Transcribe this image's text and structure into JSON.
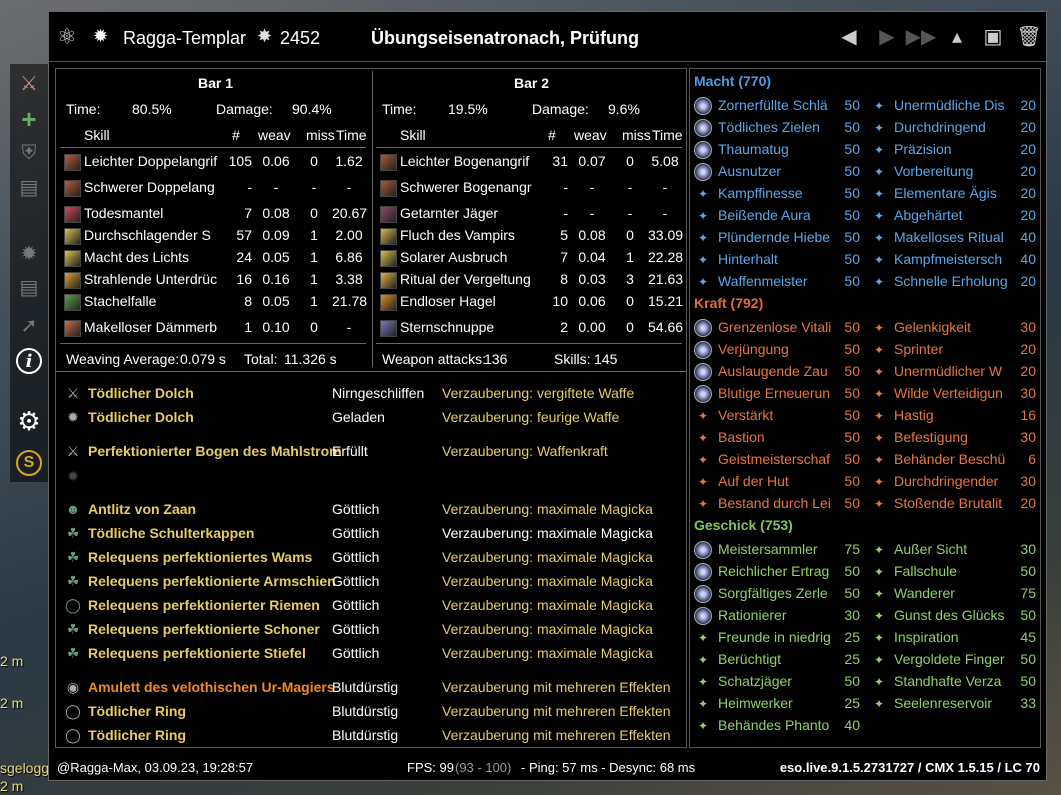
{
  "background": {
    "left_texts": [
      "2 m",
      "2 m",
      "sgeloggt.",
      "2 m"
    ]
  },
  "titlebar": {
    "character": "Ragga-Templar",
    "cp": "2452",
    "fight": "Übungseisenatronach, Prüfung"
  },
  "bar1": {
    "title": "Bar 1",
    "time_label": "Time:",
    "time": "80.5%",
    "damage_label": "Damage:",
    "damage": "90.4%",
    "cols": [
      "Skill",
      "#",
      "weav",
      "miss",
      "Time"
    ],
    "rows": [
      [
        "Leichter Doppelangrif",
        "105",
        "0.06",
        "0",
        "1.62"
      ],
      [
        "Schwerer Doppelang",
        "-",
        "-",
        "-",
        "-"
      ],
      [
        "Todesmantel",
        "7",
        "0.08",
        "0",
        "20.67"
      ],
      [
        "Durchschlagender S",
        "57",
        "0.09",
        "1",
        "2.00"
      ],
      [
        "Macht des Lichts",
        "24",
        "0.05",
        "1",
        "6.86"
      ],
      [
        "Strahlende Unterdrüc",
        "16",
        "0.16",
        "1",
        "3.38"
      ],
      [
        "Stachelfalle",
        "8",
        "0.05",
        "1",
        "21.78"
      ],
      [
        "Makelloser Dämmerb",
        "1",
        "0.10",
        "0",
        "-"
      ]
    ],
    "footer_left_label": "Weaving Average:",
    "footer_left": "0.079 s",
    "footer_right_label": "Total:",
    "footer_right": "11.326 s"
  },
  "bar2": {
    "title": "Bar 2",
    "time_label": "Time:",
    "time": "19.5%",
    "damage_label": "Damage:",
    "damage": "9.6%",
    "cols": [
      "Skill",
      "#",
      "weav",
      "miss",
      "Time"
    ],
    "rows": [
      [
        "Leichter Bogenangrif",
        "31",
        "0.07",
        "0",
        "5.08"
      ],
      [
        "Schwerer Bogenangr",
        "-",
        "-",
        "-",
        "-"
      ],
      [
        "Getarnter Jäger",
        "-",
        "-",
        "-",
        "-"
      ],
      [
        "Fluch des Vampirs",
        "5",
        "0.08",
        "0",
        "33.09"
      ],
      [
        "Solarer Ausbruch",
        "7",
        "0.04",
        "1",
        "22.28"
      ],
      [
        "Ritual der Vergeltung",
        "8",
        "0.03",
        "3",
        "21.63"
      ],
      [
        "Endloser Hagel",
        "10",
        "0.06",
        "0",
        "15.21"
      ],
      [
        "Sternschnuppe",
        "2",
        "0.00",
        "0",
        "54.66"
      ]
    ],
    "footer_left_label": "Weapon attacks:",
    "footer_left": "136",
    "footer_right_label": "Skills:",
    "footer_right": "145"
  },
  "gear": [
    {
      "name": "Tödlicher Dolch",
      "trait": "Nirngeschliffen",
      "ench": "Verzauberung: vergiftete Waffe",
      "color": "gold"
    },
    {
      "name": "Tödlicher Dolch",
      "trait": "Geladen",
      "ench": "Verzauberung: feurige Waffe",
      "color": "gold"
    },
    {
      "name": "Perfektionierter Bogen des Mahlstrom",
      "trait": "Erfüllt",
      "ench": "Verzauberung: Waffenkraft",
      "color": "gold"
    },
    {
      "name": "Antlitz von Zaan",
      "trait": "Göttlich",
      "ench": "Verzauberung: maximale Magicka",
      "color": "gold"
    },
    {
      "name": "Tödliche Schulterkappen",
      "trait": "Göttlich",
      "ench": "Verzauberung: maximale Magicka",
      "color": "gold",
      "ench_white": true
    },
    {
      "name": "Relequens perfektioniertes Wams",
      "trait": "Göttlich",
      "ench": "Verzauberung: maximale Magicka",
      "color": "gold"
    },
    {
      "name": "Relequens perfektionierte Armschien",
      "trait": "Göttlich",
      "ench": "Verzauberung: maximale Magicka",
      "color": "gold"
    },
    {
      "name": "Relequens perfektionierter Riemen",
      "trait": "Göttlich",
      "ench": "Verzauberung: maximale Magicka",
      "color": "gold"
    },
    {
      "name": "Relequens perfektionierte Schoner",
      "trait": "Göttlich",
      "ench": "Verzauberung: maximale Magicka",
      "color": "gold"
    },
    {
      "name": "Relequens perfektionierte Stiefel",
      "trait": "Göttlich",
      "ench": "Verzauberung: maximale Magicka",
      "color": "gold"
    },
    {
      "name": "Amulett des velothischen Ur-Magiers",
      "trait": "Blutdürstig",
      "ench": "Verzauberung mit mehreren Effekten",
      "color": "orange"
    },
    {
      "name": "Tödlicher Ring",
      "trait": "Blutdürstig",
      "ench": "Verzauberung mit mehreren Effekten",
      "color": "gold"
    },
    {
      "name": "Tödlicher Ring",
      "trait": "Blutdürstig",
      "ench": "Verzauberung mit mehreren Effekten",
      "color": "gold"
    }
  ],
  "cp": {
    "macht": {
      "title": "Macht (770)",
      "left": [
        [
          "Zornerfüllte Schlä",
          "50"
        ],
        [
          "Tödliches Zielen",
          "50"
        ],
        [
          "Thaumatug",
          "50"
        ],
        [
          "Ausnutzer",
          "50"
        ],
        [
          "Kampffinesse",
          "50"
        ],
        [
          "Beißende Aura",
          "50"
        ],
        [
          "Plündernde Hiebe",
          "50"
        ],
        [
          "Hinterhalt",
          "50"
        ],
        [
          "Waffenmeister",
          "50"
        ]
      ],
      "right": [
        [
          "Unermüdliche Dis",
          "20"
        ],
        [
          "Durchdringend",
          "20"
        ],
        [
          "Präzision",
          "20"
        ],
        [
          "Vorbereitung",
          "20"
        ],
        [
          "Elementare Ägis",
          "20"
        ],
        [
          "Abgehärtet",
          "20"
        ],
        [
          "Makelloses Ritual",
          "40"
        ],
        [
          "Kampfmeistersch",
          "40"
        ],
        [
          "Schnelle Erholung",
          "20"
        ]
      ]
    },
    "kraft": {
      "title": "Kraft (792)",
      "left": [
        [
          "Grenzenlose Vitali",
          "50"
        ],
        [
          "Verjüngung",
          "50"
        ],
        [
          "Auslaugende Zau",
          "50"
        ],
        [
          "Blutige Erneuerun",
          "50"
        ],
        [
          "Verstärkt",
          "50"
        ],
        [
          "Bastion",
          "50"
        ],
        [
          "Geistmeisterschaf",
          "50"
        ],
        [
          "Auf der Hut",
          "50"
        ],
        [
          "Bestand durch Lei",
          "50"
        ]
      ],
      "right": [
        [
          "Gelenkigkeit",
          "30"
        ],
        [
          "Sprinter",
          "20"
        ],
        [
          "Unermüdlicher W",
          "20"
        ],
        [
          "Wilde Verteidigun",
          "30"
        ],
        [
          "Hastig",
          "16"
        ],
        [
          "Befestigung",
          "30"
        ],
        [
          "Behänder Beschü",
          "6"
        ],
        [
          "Durchdringender",
          "30"
        ],
        [
          "Stoßende Brutalit",
          "20"
        ]
      ]
    },
    "geschick": {
      "title": "Geschick (753)",
      "left": [
        [
          "Meistersammler",
          "75"
        ],
        [
          "Reichlicher Ertrag",
          "50"
        ],
        [
          "Sorgfältiges Zerle",
          "50"
        ],
        [
          "Rationierer",
          "30"
        ],
        [
          "Freunde in niedrig",
          "25"
        ],
        [
          "Berüchtigt",
          "25"
        ],
        [
          "Schatzjäger",
          "50"
        ],
        [
          "Heimwerker",
          "25"
        ],
        [
          "Behändes Phanto",
          "40"
        ]
      ],
      "right": [
        [
          "Außer Sicht",
          "30"
        ],
        [
          "Fallschule",
          "50"
        ],
        [
          "Wanderer",
          "75"
        ],
        [
          "Gunst des Glücks",
          "50"
        ],
        [
          "Inspiration",
          "45"
        ],
        [
          "Vergoldete Finger",
          "50"
        ],
        [
          "Standhafte Verza",
          "50"
        ],
        [
          "Seelenreservoir",
          "33"
        ]
      ]
    }
  },
  "footer": {
    "user": "@Ragga-Max, 03.09.23, 19:28:57",
    "fps": "FPS: 99",
    "fps_range": "(93 - 100)",
    "ping": "- Ping: 57 ms - Desync: 68 ms",
    "version": "eso.live.9.1.5.2731727 / CMX 1.5.15 / LC 70"
  }
}
